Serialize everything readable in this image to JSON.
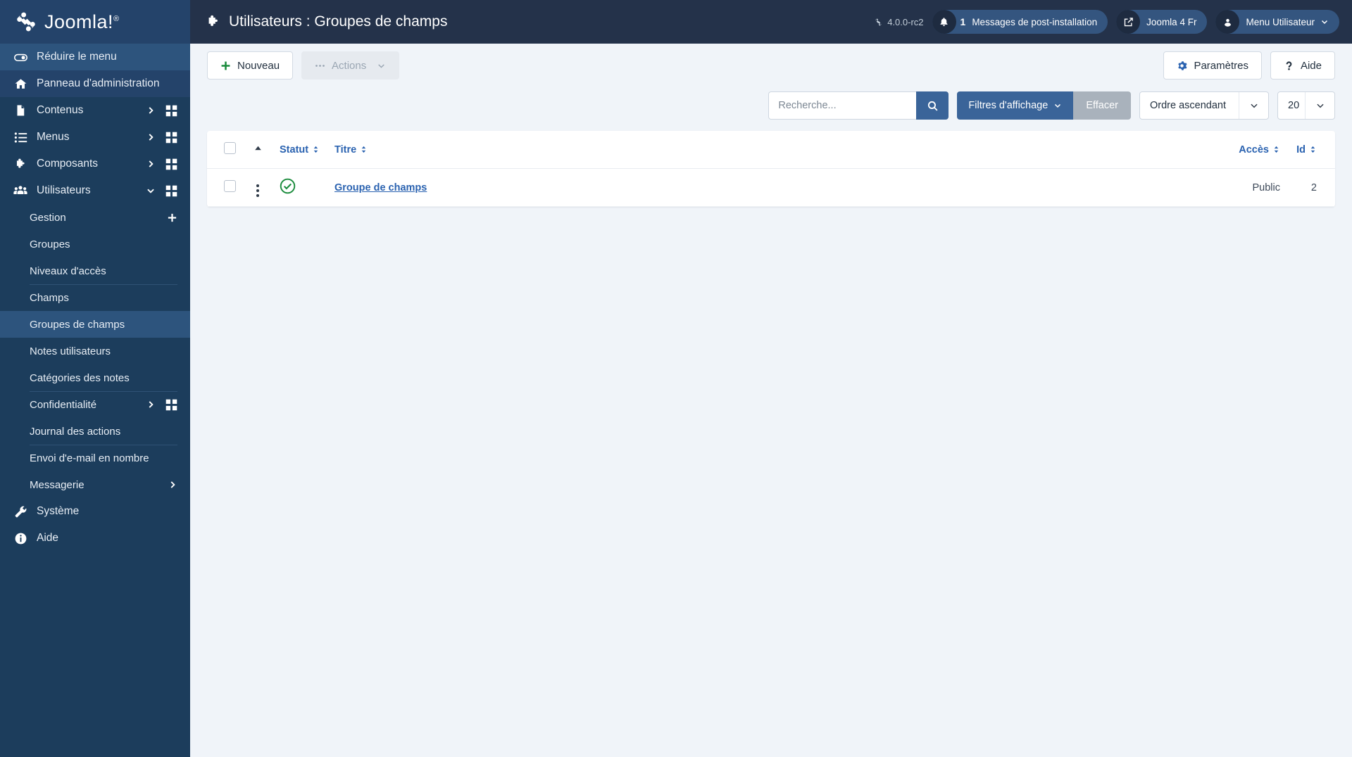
{
  "brand": {
    "name": "Joomla!",
    "trademark": "®"
  },
  "sidebar": {
    "collapse_label": "Réduire le menu",
    "items": [
      {
        "label": "Panneau d'administration",
        "icon": "home-icon",
        "has_caret": false,
        "has_grid": false,
        "active": true
      },
      {
        "label": "Contenus",
        "icon": "document-icon",
        "has_caret": true,
        "has_grid": true,
        "active": false
      },
      {
        "label": "Menus",
        "icon": "list-icon",
        "has_caret": true,
        "has_grid": true,
        "active": false
      },
      {
        "label": "Composants",
        "icon": "puzzle-icon",
        "has_caret": true,
        "has_grid": true,
        "active": false
      },
      {
        "label": "Utilisateurs",
        "icon": "users-icon",
        "has_caret": true,
        "has_grid": true,
        "expanded": true,
        "active": false
      }
    ],
    "users_submenu": [
      {
        "label": "Gestion",
        "plus": true,
        "divider": false,
        "active": false
      },
      {
        "label": "Groupes",
        "plus": false,
        "divider": false,
        "active": false
      },
      {
        "label": "Niveaux d'accès",
        "plus": false,
        "divider": false,
        "active": false
      },
      {
        "label": "Champs",
        "plus": false,
        "divider": true,
        "active": false
      },
      {
        "label": "Groupes de champs",
        "plus": false,
        "divider": false,
        "active": true
      },
      {
        "label": "Notes utilisateurs",
        "plus": false,
        "divider": false,
        "active": false
      },
      {
        "label": "Catégories des notes",
        "plus": false,
        "divider": false,
        "active": false
      },
      {
        "label": "Confidentialité",
        "plus": false,
        "divider": true,
        "caret": true,
        "grid": true,
        "active": false
      },
      {
        "label": "Journal des actions",
        "plus": false,
        "divider": false,
        "active": false
      },
      {
        "label": "Envoi d'e-mail en nombre",
        "plus": false,
        "divider": true,
        "active": false
      },
      {
        "label": "Messagerie",
        "plus": false,
        "divider": false,
        "caret": true,
        "active": false
      }
    ],
    "bottom_items": [
      {
        "label": "Système",
        "icon": "wrench-icon"
      },
      {
        "label": "Aide",
        "icon": "info-icon"
      }
    ]
  },
  "header": {
    "title": "Utilisateurs : Groupes de champs",
    "title_icon": "puzzle-icon",
    "version": "4.0.0-rc2",
    "notifications": {
      "count": "1",
      "label": "Messages de post-installation",
      "icon": "bell-icon"
    },
    "site_link": {
      "label": "Joomla 4 Fr",
      "icon": "external-link-icon"
    },
    "user_menu": {
      "label": "Menu Utilisateur",
      "icon": "user-icon"
    }
  },
  "toolbar": {
    "new_label": "Nouveau",
    "actions_label": "Actions",
    "options_label": "Paramètres",
    "help_label": "Aide"
  },
  "filters": {
    "search_placeholder": "Recherche...",
    "search_value": "",
    "filters_label": "Filtres d'affichage",
    "clear_label": "Effacer",
    "order_value": "Ordre ascendant",
    "limit_value": "20"
  },
  "table": {
    "columns": [
      {
        "key": "checkbox",
        "label": ""
      },
      {
        "key": "ordering",
        "label": ""
      },
      {
        "key": "status",
        "label": "Statut",
        "sortable": true
      },
      {
        "key": "title",
        "label": "Titre",
        "sortable": true
      },
      {
        "key": "access",
        "label": "Accès",
        "sortable": true
      },
      {
        "key": "id",
        "label": "Id",
        "sortable": true
      }
    ],
    "rows": [
      {
        "title": "Groupe de champs",
        "status": "published",
        "access": "Public",
        "id": "2"
      }
    ]
  },
  "colors": {
    "sidebar_bg": "#1c3d5c",
    "sidebar_active": "#2d547d",
    "brand_bg": "#24436a",
    "topbar_bg": "#24324a",
    "accent_blue": "#3a6499",
    "link_blue": "#2a62b0",
    "success_green": "#1a8b3c",
    "page_bg": "#f0f4f9"
  }
}
